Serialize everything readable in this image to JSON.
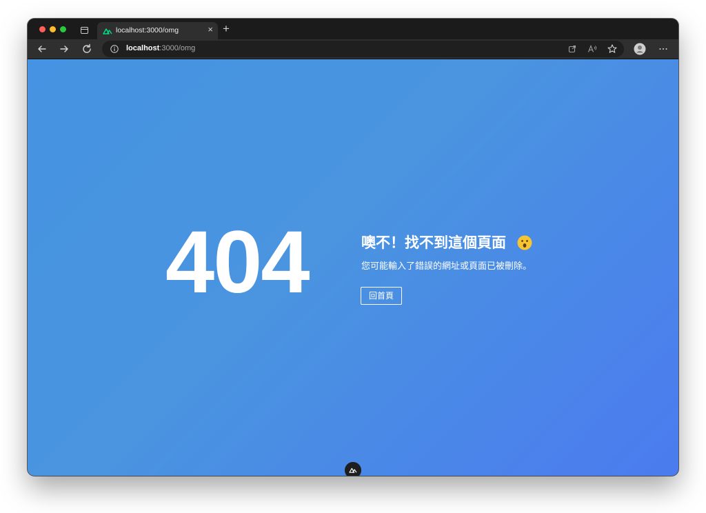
{
  "browser": {
    "tab_title": "localhost:3000/omg",
    "tab_close": "×",
    "new_tab": "+",
    "url_host": "localhost",
    "url_path": ":3000/omg"
  },
  "page": {
    "code": "404",
    "title": "噢不！找不到這個頁面",
    "description": "您可能輸入了錯誤的網址或頁面已被刪除。",
    "home_button": "回首頁"
  },
  "colors": {
    "gradient_start": "#4593e2",
    "gradient_end": "#4b7bef",
    "nuxt_green": "#00dc82"
  },
  "icons": [
    "tab-actions-icon",
    "nuxt-logo-icon",
    "close-icon",
    "plus-icon",
    "back-arrow-icon",
    "forward-arrow-icon",
    "reload-icon",
    "info-icon",
    "share-icon",
    "read-aloud-icon",
    "favorite-star-icon",
    "profile-avatar-icon",
    "more-options-icon",
    "surprised-face-emoji-icon",
    "nuxt-devtools-icon"
  ]
}
